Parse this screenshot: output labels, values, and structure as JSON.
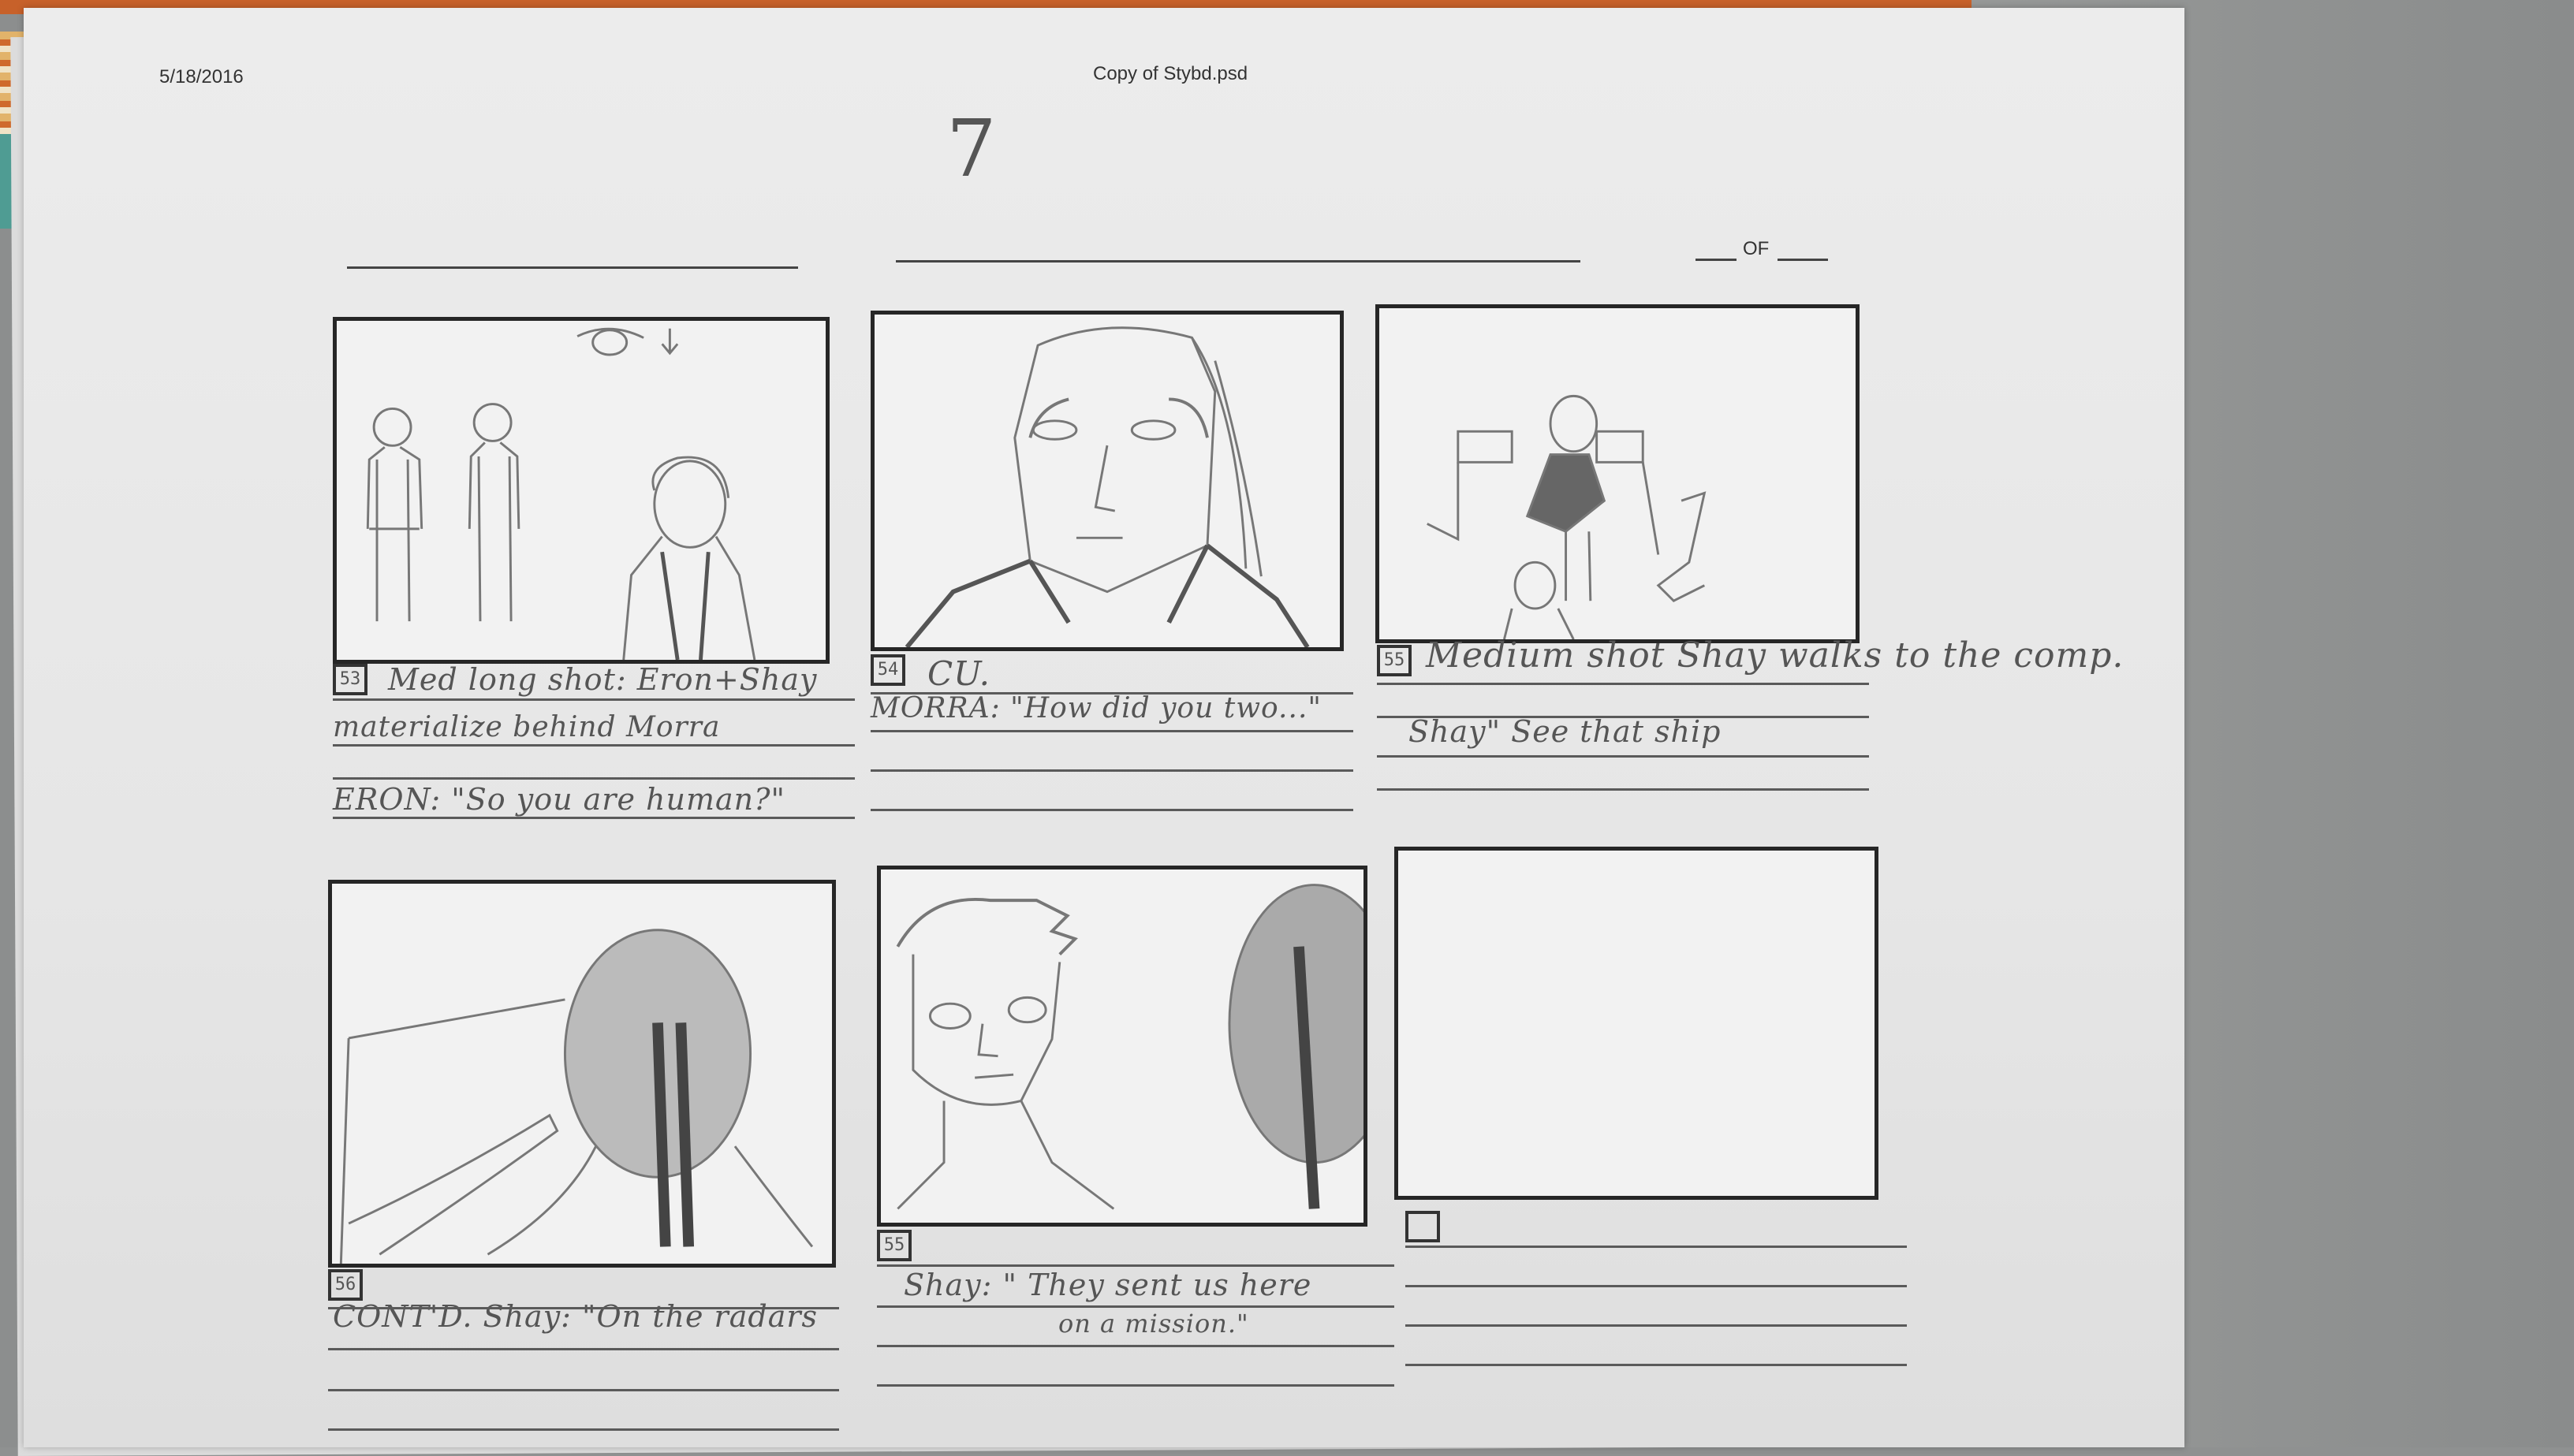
{
  "header": {
    "date": "5/18/2016",
    "file_name": "Copy of Stybd.psd",
    "page_number": "7",
    "of_label": "OF"
  },
  "panels": [
    {
      "number": "53",
      "lines": [
        "Med long shot: Eron+Shay",
        "materialize behind Morra",
        "ERON: \"So you are human?\""
      ]
    },
    {
      "number": "54",
      "lines": [
        "CU.",
        "MORRA: \"How did you two...\""
      ]
    },
    {
      "number": "55",
      "lines": [
        "Medium shot  Shay walks to the comp.",
        "Shay\" See that ship"
      ]
    },
    {
      "number": "56",
      "lines": [
        "CONT'D. Shay: \"On the radars"
      ]
    },
    {
      "number": "55",
      "lines": [
        "Shay: \" They sent us here",
        "on a mission.\""
      ]
    },
    {
      "number": "",
      "lines": []
    }
  ]
}
